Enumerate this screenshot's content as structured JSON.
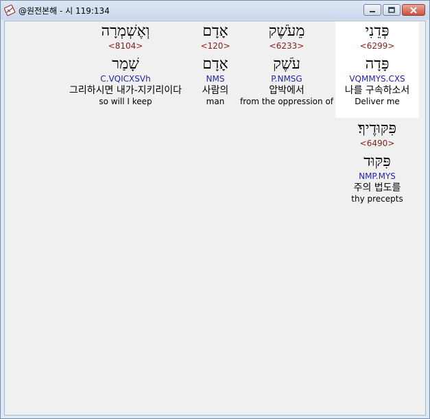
{
  "window": {
    "title": "@원전본해 - 시 119:134",
    "icon": "app-book-icon"
  },
  "words": [
    {
      "hebrew": "פְּדֵנִי",
      "strongs": "<6299>",
      "lemma": "פָּדָה",
      "morph": "VQMMYS.CXS",
      "korean": "나를 구속하소서",
      "english": "Deliver me"
    },
    {
      "hebrew": "מֵעֹשֶׁק",
      "strongs": "<6233>",
      "lemma": "עֹשֶׁק",
      "morph": "P.NMSG",
      "korean": "압박에서",
      "english": "from the oppression of"
    },
    {
      "hebrew": "אָדָם",
      "strongs": "<120>",
      "lemma": "אָדָם",
      "morph": "NMS",
      "korean": "사람의",
      "english": "man"
    },
    {
      "hebrew": "וְאֶשְׁמְרָה",
      "strongs": "<8104>",
      "lemma": "שָׁמַר",
      "morph": "C.VQICXSVh",
      "korean": "그리하시면 내가-지키리이다",
      "english": "so will I keep"
    },
    {
      "hebrew": "פִּקּוּדֶיךָ׃",
      "strongs": "<6490>",
      "lemma": "פִּקּוּד",
      "morph": "NMP.MYS",
      "korean": "주의 법도를",
      "english": "thy precepts"
    }
  ],
  "colors": {
    "strongs": "#8b1a1a",
    "morph": "#1f1fb4",
    "selection": "#ffffff"
  }
}
